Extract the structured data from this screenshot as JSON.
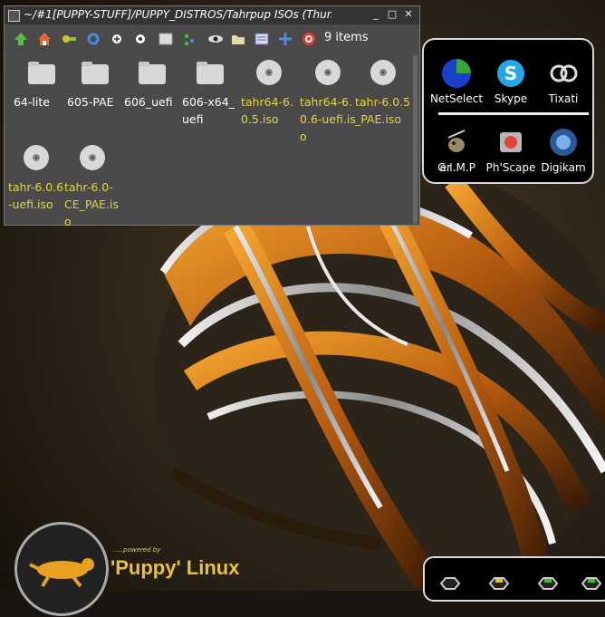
{
  "window": {
    "title": "~/#1[PUPPY-STUFF]/PUPPY_DISTROS/Tahrpup ISOs (Thum",
    "buttons": {
      "minimize": "_",
      "maximize": "□",
      "close": "✕"
    }
  },
  "toolbar": {
    "icons": [
      "up-arrow-icon",
      "home-icon",
      "bookmark-icon",
      "refresh-icon",
      "zoom-in-icon",
      "zoom-out-icon",
      "select-all-icon",
      "filter-icon",
      "eye-icon",
      "folder-icon",
      "details-icon",
      "add-icon",
      "help-icon"
    ],
    "items_count": "9 items"
  },
  "files": [
    {
      "label": "64-lite",
      "type": "folder"
    },
    {
      "label": "605-PAE",
      "type": "folder"
    },
    {
      "label": "606_uefi",
      "type": "folder"
    },
    {
      "label": "606-x64_uefi",
      "type": "folder"
    },
    {
      "label": "tahr64-6.0.5.iso",
      "type": "iso"
    },
    {
      "label": "tahr64-6.0.6-uefi.iso",
      "type": "iso"
    },
    {
      "label": "tahr-6.0.5_PAE.iso",
      "type": "iso"
    },
    {
      "label": "tahr-6.0.6-uefi.iso",
      "type": "iso"
    },
    {
      "label": "tahr-6.0-CE_PAE.iso",
      "type": "iso"
    }
  ],
  "launcher": {
    "items": [
      {
        "label": "NetSelect"
      },
      {
        "label": "Skype"
      },
      {
        "label": "Tixati"
      },
      {
        "label": "er"
      },
      {
        "label": "G.I.M.P"
      },
      {
        "label": "Ph'Scape"
      },
      {
        "label": "Digikam"
      }
    ]
  },
  "branding": {
    "powered": ".....powered by",
    "name": "'Puppy' Linux"
  },
  "colors": {
    "folder_text": "#ffffff",
    "iso_text": "#e6d43a",
    "wallpaper_accent": "#d97a1a"
  }
}
